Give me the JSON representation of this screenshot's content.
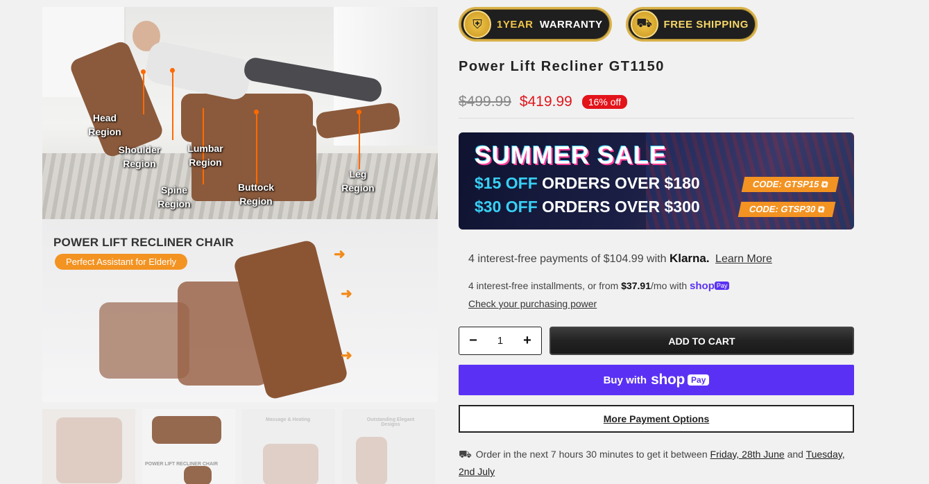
{
  "gallery": {
    "hero1_labels": {
      "head": "Head\nRegion",
      "shoulder": "Shoulder\nRegion",
      "spine": "Spine\nRegion",
      "lumbar": "Lumbar\nRegion",
      "buttock": "Buttock\nRegion",
      "leg": "Leg\nRegion"
    },
    "hero2": {
      "title": "POWER LIFT RECLINER CHAIR",
      "pill": "Perfect Assistant for Elderly"
    },
    "thumbnails": {
      "thumb3_text": "Massage & Heating",
      "thumb4_text": "Outstanding Elegant Designs",
      "thumb2_text": "POWER LIFT RECLINER CHAIR"
    }
  },
  "badges": {
    "warranty": {
      "prefix": "1YEAR",
      "label": "WARRANTY"
    },
    "shipping": {
      "label": "FREE SHIPPING"
    }
  },
  "product": {
    "title": "Power Lift Recliner GT1150",
    "old_price": "$499.99",
    "new_price": "$419.99",
    "discount": "16% off"
  },
  "banner": {
    "headline": "SUMMER SALE",
    "offers": [
      {
        "amount": "$15 OFF",
        "rest": "ORDERS OVER $180",
        "code": "CODE: GTSP15 ⧉"
      },
      {
        "amount": "$30 OFF",
        "rest": "ORDERS OVER $300",
        "code": "CODE: GTSP30 ⧉"
      }
    ]
  },
  "klarna": {
    "text": "4 interest-free payments of $104.99 with",
    "brand": "Klarna.",
    "link": "Learn More"
  },
  "shoppay": {
    "text_before": "4 interest-free installments, or from",
    "amount": "$37.91",
    "text_after": "/mo with",
    "brand": "shop",
    "pay": "Pay",
    "check_link": "Check your purchasing power"
  },
  "cart": {
    "minus": "−",
    "quantity": "1",
    "plus": "+",
    "add_label": "ADD TO CART"
  },
  "buy_shop": {
    "prefix": "Buy with",
    "logo": "shop",
    "pay": "Pay"
  },
  "more_payment": "More Payment Options",
  "delivery": {
    "icon": "⛟",
    "text": "Order in the next 7 hours 30 minutes to get it between",
    "date1": "Friday, 28th June",
    "and": "and",
    "date2": "Tuesday, 2nd July"
  }
}
